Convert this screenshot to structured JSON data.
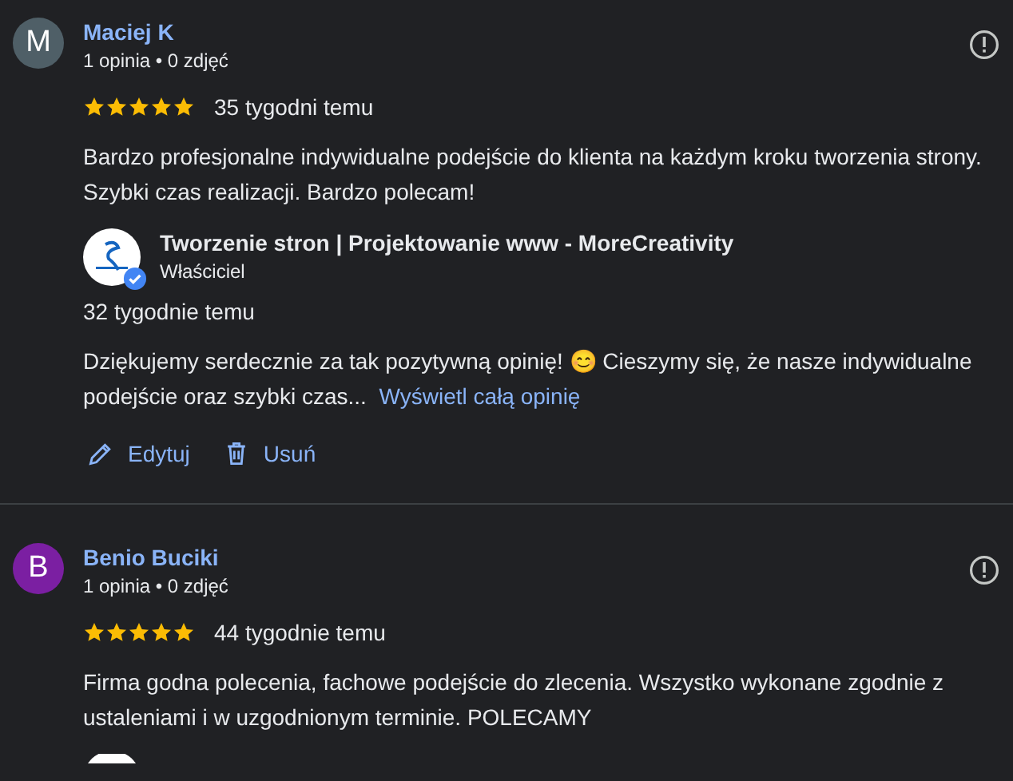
{
  "reviews": [
    {
      "avatar_letter": "M",
      "color": "#4f5f67",
      "name": "Maciej K",
      "meta": "1 opinia • 0 zdjęć",
      "stars": 5,
      "time": "35 tygodni temu",
      "text": "Bardzo profesjonalne indywidualne podejście do klienta na każdym kroku tworzenia strony. Szybki czas realizacji. Bardzo polecam!",
      "reply": {
        "owner": "Tworzenie stron | Projektowanie www - MoreCreativity",
        "role": "Właściciel",
        "verified": true,
        "time": "32 tygodnie temu",
        "text": "Dziękujemy serdecznie za tak pozytywną opinię! 😊 Cieszymy się, że nasze indywidualne podejście oraz szybki czas...",
        "more": "Wyświetl całą opinię"
      },
      "actions": [
        {
          "kind": "edit",
          "label": "Edytuj"
        },
        {
          "kind": "delete",
          "label": "Usuń"
        }
      ]
    },
    {
      "avatar_letter": "B",
      "color": "#7b1fa2",
      "name": "Benio Buciki",
      "meta": "1 opinia • 0 zdjęć",
      "stars": 5,
      "time": "44 tygodnie temu",
      "text": "Firma godna polecenia, fachowe podejście do zlecenia. Wszystko wykonane zgodnie z ustaleniami i w uzgodnionym terminie. POLECAMY",
      "reply_peek": true
    }
  ]
}
